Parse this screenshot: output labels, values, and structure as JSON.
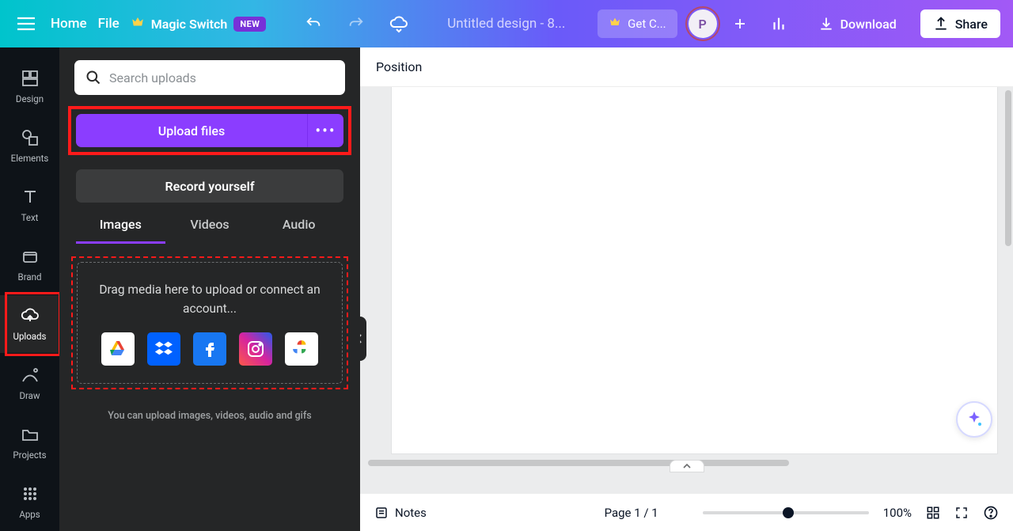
{
  "topbar": {
    "home": "Home",
    "file": "File",
    "magic_switch": "Magic Switch",
    "new_badge": "NEW",
    "title_placeholder": "Untitled design - 8...",
    "get_canva": "Get C...",
    "avatar_initial": "P",
    "download": "Download",
    "share": "Share"
  },
  "rail": {
    "design": "Design",
    "elements": "Elements",
    "text": "Text",
    "brand": "Brand",
    "uploads": "Uploads",
    "draw": "Draw",
    "projects": "Projects",
    "apps": "Apps"
  },
  "panel": {
    "search_placeholder": "Search uploads",
    "upload_files": "Upload files",
    "record_yourself": "Record yourself",
    "tabs": {
      "images": "Images",
      "videos": "Videos",
      "audio": "Audio"
    },
    "drop_text": "Drag media here to upload or connect an account...",
    "hint": "You can upload images, videos, audio and gifs"
  },
  "canvas": {
    "position": "Position"
  },
  "footer": {
    "notes": "Notes",
    "page_label": "Page 1 / 1",
    "zoom": "100%"
  }
}
